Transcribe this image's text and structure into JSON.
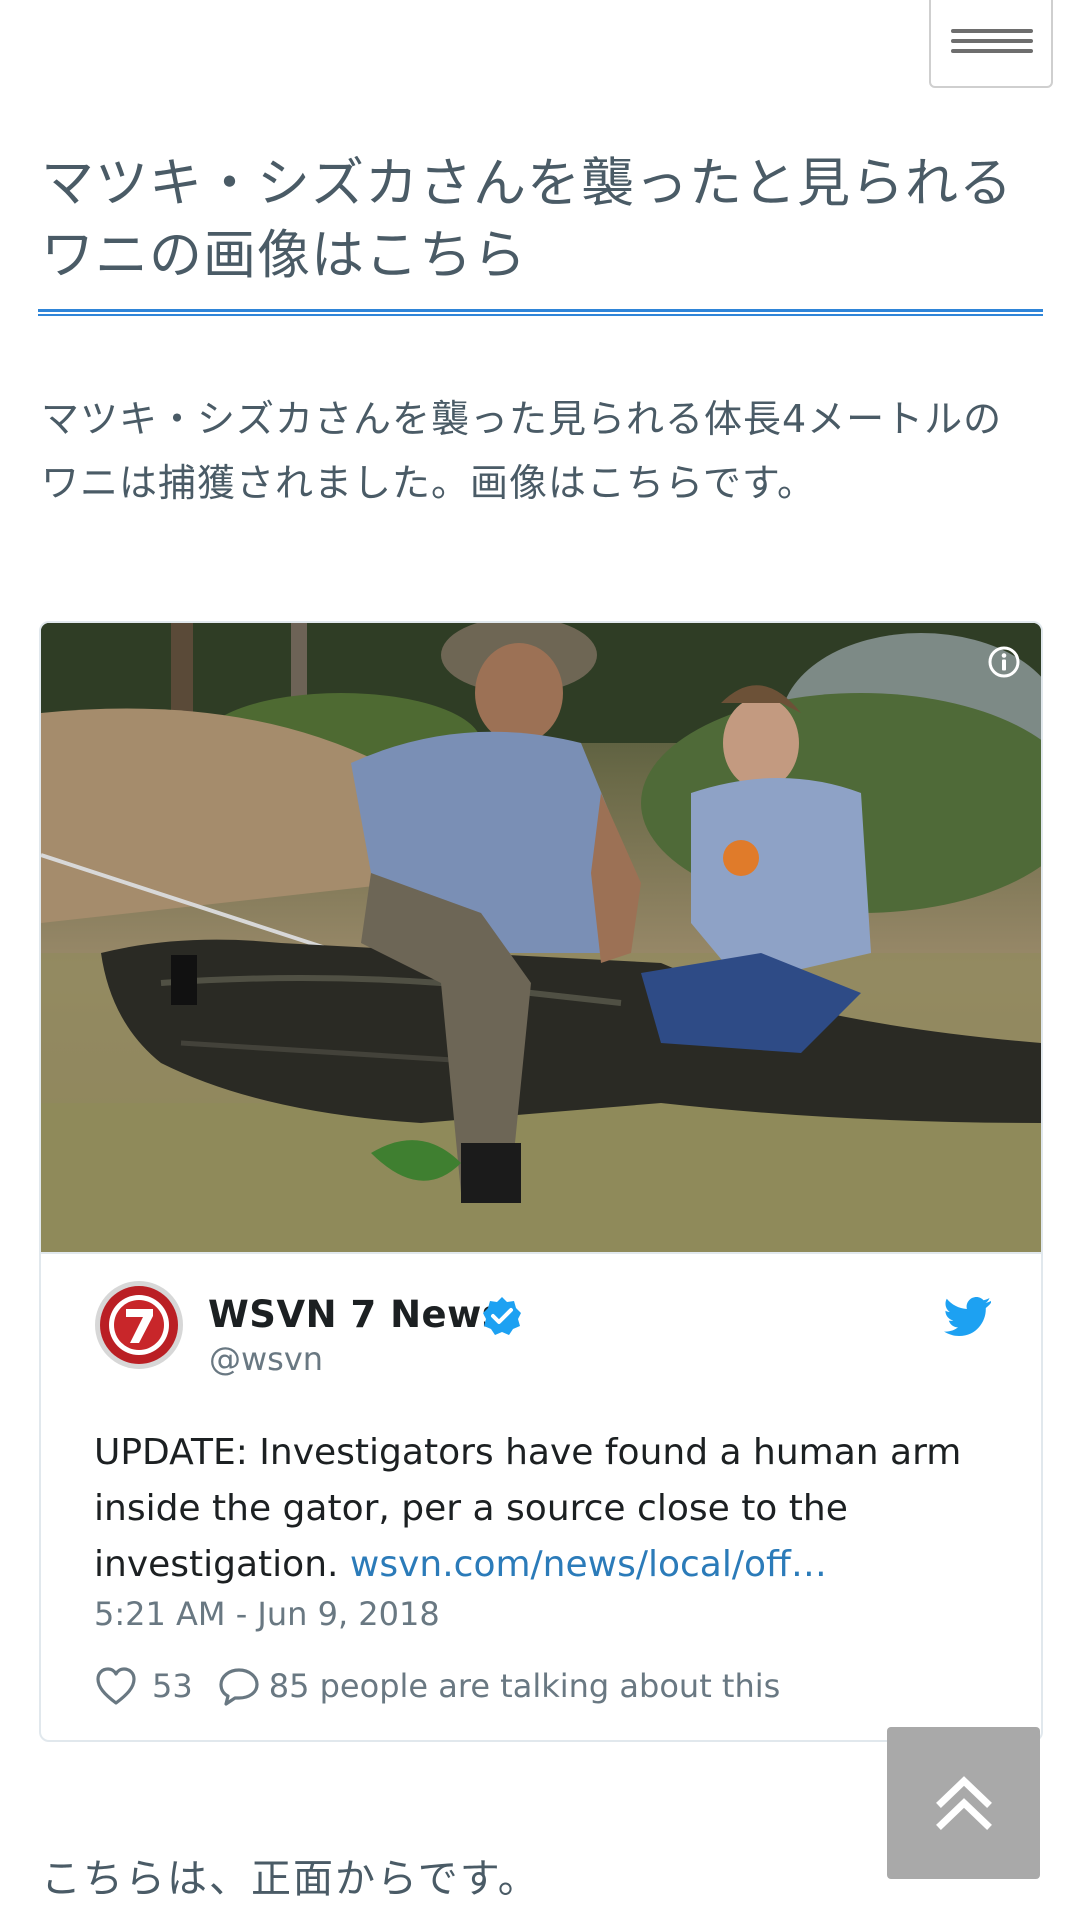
{
  "header": {
    "menu_icon": "hamburger-menu-icon"
  },
  "article": {
    "headline": "マツキ・シズカさんを襲ったと見られるワニの画像はこちら",
    "lead": "マツキ・シズカさんを襲った見られる体長4メートルのワニは捕獲されました。画像はこちらです。",
    "footer_text": "こちらは、正面からです。"
  },
  "tweet": {
    "author_name": "WSVN 7 News",
    "author_handle": "@wsvn",
    "text": "UPDATE: Investigators have found a human arm inside the gator, per a source close to the investigation. ",
    "link": "wsvn.com/news/local/off…",
    "timestamp": "5:21 AM - Jun 9, 2018",
    "likes": "53",
    "talking": "85 people are talking about this",
    "icons": {
      "info": "info-icon",
      "verified": "verified-badge-icon",
      "twitter": "twitter-bird-icon",
      "heart": "heart-icon",
      "reply": "speech-bubble-icon"
    },
    "colors": {
      "link": "#2b7bb9",
      "verified": "#1da1f2",
      "twitter": "#1da1f2"
    }
  },
  "back_to_top": {
    "icon": "double-chevron-up-icon"
  },
  "theme": {
    "accent": "#2f85d8",
    "text": "#4a5b66"
  }
}
